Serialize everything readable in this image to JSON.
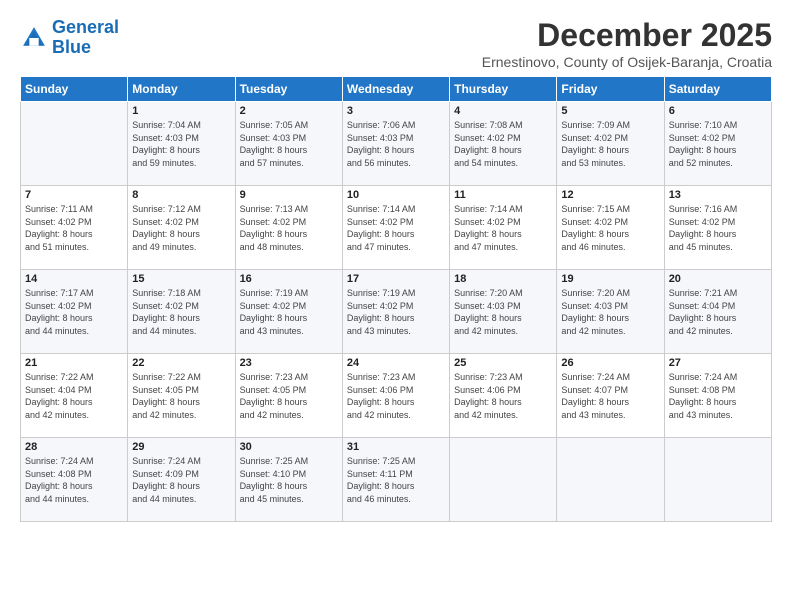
{
  "header": {
    "logo_line1": "General",
    "logo_line2": "Blue",
    "month": "December 2025",
    "location": "Ernestinovo, County of Osijek-Baranja, Croatia"
  },
  "weekdays": [
    "Sunday",
    "Monday",
    "Tuesday",
    "Wednesday",
    "Thursday",
    "Friday",
    "Saturday"
  ],
  "weeks": [
    [
      {
        "day": "",
        "info": ""
      },
      {
        "day": "1",
        "info": "Sunrise: 7:04 AM\nSunset: 4:03 PM\nDaylight: 8 hours\nand 59 minutes."
      },
      {
        "day": "2",
        "info": "Sunrise: 7:05 AM\nSunset: 4:03 PM\nDaylight: 8 hours\nand 57 minutes."
      },
      {
        "day": "3",
        "info": "Sunrise: 7:06 AM\nSunset: 4:03 PM\nDaylight: 8 hours\nand 56 minutes."
      },
      {
        "day": "4",
        "info": "Sunrise: 7:08 AM\nSunset: 4:02 PM\nDaylight: 8 hours\nand 54 minutes."
      },
      {
        "day": "5",
        "info": "Sunrise: 7:09 AM\nSunset: 4:02 PM\nDaylight: 8 hours\nand 53 minutes."
      },
      {
        "day": "6",
        "info": "Sunrise: 7:10 AM\nSunset: 4:02 PM\nDaylight: 8 hours\nand 52 minutes."
      }
    ],
    [
      {
        "day": "7",
        "info": "Sunrise: 7:11 AM\nSunset: 4:02 PM\nDaylight: 8 hours\nand 51 minutes."
      },
      {
        "day": "8",
        "info": "Sunrise: 7:12 AM\nSunset: 4:02 PM\nDaylight: 8 hours\nand 49 minutes."
      },
      {
        "day": "9",
        "info": "Sunrise: 7:13 AM\nSunset: 4:02 PM\nDaylight: 8 hours\nand 48 minutes."
      },
      {
        "day": "10",
        "info": "Sunrise: 7:14 AM\nSunset: 4:02 PM\nDaylight: 8 hours\nand 47 minutes."
      },
      {
        "day": "11",
        "info": "Sunrise: 7:14 AM\nSunset: 4:02 PM\nDaylight: 8 hours\nand 47 minutes."
      },
      {
        "day": "12",
        "info": "Sunrise: 7:15 AM\nSunset: 4:02 PM\nDaylight: 8 hours\nand 46 minutes."
      },
      {
        "day": "13",
        "info": "Sunrise: 7:16 AM\nSunset: 4:02 PM\nDaylight: 8 hours\nand 45 minutes."
      }
    ],
    [
      {
        "day": "14",
        "info": "Sunrise: 7:17 AM\nSunset: 4:02 PM\nDaylight: 8 hours\nand 44 minutes."
      },
      {
        "day": "15",
        "info": "Sunrise: 7:18 AM\nSunset: 4:02 PM\nDaylight: 8 hours\nand 44 minutes."
      },
      {
        "day": "16",
        "info": "Sunrise: 7:19 AM\nSunset: 4:02 PM\nDaylight: 8 hours\nand 43 minutes."
      },
      {
        "day": "17",
        "info": "Sunrise: 7:19 AM\nSunset: 4:02 PM\nDaylight: 8 hours\nand 43 minutes."
      },
      {
        "day": "18",
        "info": "Sunrise: 7:20 AM\nSunset: 4:03 PM\nDaylight: 8 hours\nand 42 minutes."
      },
      {
        "day": "19",
        "info": "Sunrise: 7:20 AM\nSunset: 4:03 PM\nDaylight: 8 hours\nand 42 minutes."
      },
      {
        "day": "20",
        "info": "Sunrise: 7:21 AM\nSunset: 4:04 PM\nDaylight: 8 hours\nand 42 minutes."
      }
    ],
    [
      {
        "day": "21",
        "info": "Sunrise: 7:22 AM\nSunset: 4:04 PM\nDaylight: 8 hours\nand 42 minutes."
      },
      {
        "day": "22",
        "info": "Sunrise: 7:22 AM\nSunset: 4:05 PM\nDaylight: 8 hours\nand 42 minutes."
      },
      {
        "day": "23",
        "info": "Sunrise: 7:23 AM\nSunset: 4:05 PM\nDaylight: 8 hours\nand 42 minutes."
      },
      {
        "day": "24",
        "info": "Sunrise: 7:23 AM\nSunset: 4:06 PM\nDaylight: 8 hours\nand 42 minutes."
      },
      {
        "day": "25",
        "info": "Sunrise: 7:23 AM\nSunset: 4:06 PM\nDaylight: 8 hours\nand 42 minutes."
      },
      {
        "day": "26",
        "info": "Sunrise: 7:24 AM\nSunset: 4:07 PM\nDaylight: 8 hours\nand 43 minutes."
      },
      {
        "day": "27",
        "info": "Sunrise: 7:24 AM\nSunset: 4:08 PM\nDaylight: 8 hours\nand 43 minutes."
      }
    ],
    [
      {
        "day": "28",
        "info": "Sunrise: 7:24 AM\nSunset: 4:08 PM\nDaylight: 8 hours\nand 44 minutes."
      },
      {
        "day": "29",
        "info": "Sunrise: 7:24 AM\nSunset: 4:09 PM\nDaylight: 8 hours\nand 44 minutes."
      },
      {
        "day": "30",
        "info": "Sunrise: 7:25 AM\nSunset: 4:10 PM\nDaylight: 8 hours\nand 45 minutes."
      },
      {
        "day": "31",
        "info": "Sunrise: 7:25 AM\nSunset: 4:11 PM\nDaylight: 8 hours\nand 46 minutes."
      },
      {
        "day": "",
        "info": ""
      },
      {
        "day": "",
        "info": ""
      },
      {
        "day": "",
        "info": ""
      }
    ]
  ]
}
